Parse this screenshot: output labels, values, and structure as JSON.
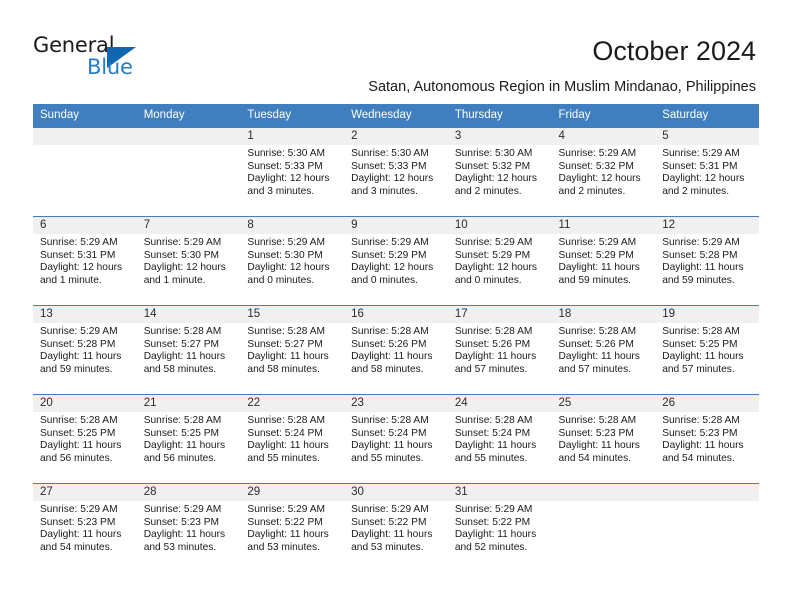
{
  "brand": {
    "name_top": "General",
    "name_bottom": "Blue",
    "accent_color": "#1166b0",
    "blue_text_color": "#2b7cc4"
  },
  "header": {
    "title": "October 2024",
    "subtitle": "Satan, Autonomous Region in Muslim Mindanao, Philippines",
    "header_bg": "#3f7fbf"
  },
  "calendar": {
    "weekday_headers": [
      "Sunday",
      "Monday",
      "Tuesday",
      "Wednesday",
      "Thursday",
      "Friday",
      "Saturday"
    ],
    "labels": {
      "sunrise": "Sunrise:",
      "sunset": "Sunset:",
      "daylight": "Daylight:"
    },
    "weeks": [
      [
        {
          "day": "",
          "empty": true
        },
        {
          "day": "",
          "empty": true
        },
        {
          "day": "1",
          "sunrise": "Sunrise: 5:30 AM",
          "sunset": "Sunset: 5:33 PM",
          "daylight_1": "Daylight: 12 hours",
          "daylight_2": "and 3 minutes."
        },
        {
          "day": "2",
          "sunrise": "Sunrise: 5:30 AM",
          "sunset": "Sunset: 5:33 PM",
          "daylight_1": "Daylight: 12 hours",
          "daylight_2": "and 3 minutes."
        },
        {
          "day": "3",
          "sunrise": "Sunrise: 5:30 AM",
          "sunset": "Sunset: 5:32 PM",
          "daylight_1": "Daylight: 12 hours",
          "daylight_2": "and 2 minutes."
        },
        {
          "day": "4",
          "sunrise": "Sunrise: 5:29 AM",
          "sunset": "Sunset: 5:32 PM",
          "daylight_1": "Daylight: 12 hours",
          "daylight_2": "and 2 minutes."
        },
        {
          "day": "5",
          "sunrise": "Sunrise: 5:29 AM",
          "sunset": "Sunset: 5:31 PM",
          "daylight_1": "Daylight: 12 hours",
          "daylight_2": "and 2 minutes."
        }
      ],
      [
        {
          "day": "6",
          "sunrise": "Sunrise: 5:29 AM",
          "sunset": "Sunset: 5:31 PM",
          "daylight_1": "Daylight: 12 hours",
          "daylight_2": "and 1 minute."
        },
        {
          "day": "7",
          "sunrise": "Sunrise: 5:29 AM",
          "sunset": "Sunset: 5:30 PM",
          "daylight_1": "Daylight: 12 hours",
          "daylight_2": "and 1 minute."
        },
        {
          "day": "8",
          "sunrise": "Sunrise: 5:29 AM",
          "sunset": "Sunset: 5:30 PM",
          "daylight_1": "Daylight: 12 hours",
          "daylight_2": "and 0 minutes."
        },
        {
          "day": "9",
          "sunrise": "Sunrise: 5:29 AM",
          "sunset": "Sunset: 5:29 PM",
          "daylight_1": "Daylight: 12 hours",
          "daylight_2": "and 0 minutes."
        },
        {
          "day": "10",
          "sunrise": "Sunrise: 5:29 AM",
          "sunset": "Sunset: 5:29 PM",
          "daylight_1": "Daylight: 12 hours",
          "daylight_2": "and 0 minutes."
        },
        {
          "day": "11",
          "sunrise": "Sunrise: 5:29 AM",
          "sunset": "Sunset: 5:29 PM",
          "daylight_1": "Daylight: 11 hours",
          "daylight_2": "and 59 minutes."
        },
        {
          "day": "12",
          "sunrise": "Sunrise: 5:29 AM",
          "sunset": "Sunset: 5:28 PM",
          "daylight_1": "Daylight: 11 hours",
          "daylight_2": "and 59 minutes."
        }
      ],
      [
        {
          "day": "13",
          "sunrise": "Sunrise: 5:29 AM",
          "sunset": "Sunset: 5:28 PM",
          "daylight_1": "Daylight: 11 hours",
          "daylight_2": "and 59 minutes."
        },
        {
          "day": "14",
          "sunrise": "Sunrise: 5:28 AM",
          "sunset": "Sunset: 5:27 PM",
          "daylight_1": "Daylight: 11 hours",
          "daylight_2": "and 58 minutes."
        },
        {
          "day": "15",
          "sunrise": "Sunrise: 5:28 AM",
          "sunset": "Sunset: 5:27 PM",
          "daylight_1": "Daylight: 11 hours",
          "daylight_2": "and 58 minutes."
        },
        {
          "day": "16",
          "sunrise": "Sunrise: 5:28 AM",
          "sunset": "Sunset: 5:26 PM",
          "daylight_1": "Daylight: 11 hours",
          "daylight_2": "and 58 minutes."
        },
        {
          "day": "17",
          "sunrise": "Sunrise: 5:28 AM",
          "sunset": "Sunset: 5:26 PM",
          "daylight_1": "Daylight: 11 hours",
          "daylight_2": "and 57 minutes."
        },
        {
          "day": "18",
          "sunrise": "Sunrise: 5:28 AM",
          "sunset": "Sunset: 5:26 PM",
          "daylight_1": "Daylight: 11 hours",
          "daylight_2": "and 57 minutes."
        },
        {
          "day": "19",
          "sunrise": "Sunrise: 5:28 AM",
          "sunset": "Sunset: 5:25 PM",
          "daylight_1": "Daylight: 11 hours",
          "daylight_2": "and 57 minutes."
        }
      ],
      [
        {
          "day": "20",
          "sunrise": "Sunrise: 5:28 AM",
          "sunset": "Sunset: 5:25 PM",
          "daylight_1": "Daylight: 11 hours",
          "daylight_2": "and 56 minutes."
        },
        {
          "day": "21",
          "sunrise": "Sunrise: 5:28 AM",
          "sunset": "Sunset: 5:25 PM",
          "daylight_1": "Daylight: 11 hours",
          "daylight_2": "and 56 minutes."
        },
        {
          "day": "22",
          "sunrise": "Sunrise: 5:28 AM",
          "sunset": "Sunset: 5:24 PM",
          "daylight_1": "Daylight: 11 hours",
          "daylight_2": "and 55 minutes."
        },
        {
          "day": "23",
          "sunrise": "Sunrise: 5:28 AM",
          "sunset": "Sunset: 5:24 PM",
          "daylight_1": "Daylight: 11 hours",
          "daylight_2": "and 55 minutes."
        },
        {
          "day": "24",
          "sunrise": "Sunrise: 5:28 AM",
          "sunset": "Sunset: 5:24 PM",
          "daylight_1": "Daylight: 11 hours",
          "daylight_2": "and 55 minutes."
        },
        {
          "day": "25",
          "sunrise": "Sunrise: 5:28 AM",
          "sunset": "Sunset: 5:23 PM",
          "daylight_1": "Daylight: 11 hours",
          "daylight_2": "and 54 minutes."
        },
        {
          "day": "26",
          "sunrise": "Sunrise: 5:28 AM",
          "sunset": "Sunset: 5:23 PM",
          "daylight_1": "Daylight: 11 hours",
          "daylight_2": "and 54 minutes."
        }
      ],
      [
        {
          "day": "27",
          "sunrise": "Sunrise: 5:29 AM",
          "sunset": "Sunset: 5:23 PM",
          "daylight_1": "Daylight: 11 hours",
          "daylight_2": "and 54 minutes."
        },
        {
          "day": "28",
          "sunrise": "Sunrise: 5:29 AM",
          "sunset": "Sunset: 5:23 PM",
          "daylight_1": "Daylight: 11 hours",
          "daylight_2": "and 53 minutes."
        },
        {
          "day": "29",
          "sunrise": "Sunrise: 5:29 AM",
          "sunset": "Sunset: 5:22 PM",
          "daylight_1": "Daylight: 11 hours",
          "daylight_2": "and 53 minutes."
        },
        {
          "day": "30",
          "sunrise": "Sunrise: 5:29 AM",
          "sunset": "Sunset: 5:22 PM",
          "daylight_1": "Daylight: 11 hours",
          "daylight_2": "and 53 minutes."
        },
        {
          "day": "31",
          "sunrise": "Sunrise: 5:29 AM",
          "sunset": "Sunset: 5:22 PM",
          "daylight_1": "Daylight: 11 hours",
          "daylight_2": "and 52 minutes."
        },
        {
          "day": "",
          "empty": true
        },
        {
          "day": "",
          "empty": true
        }
      ]
    ]
  }
}
